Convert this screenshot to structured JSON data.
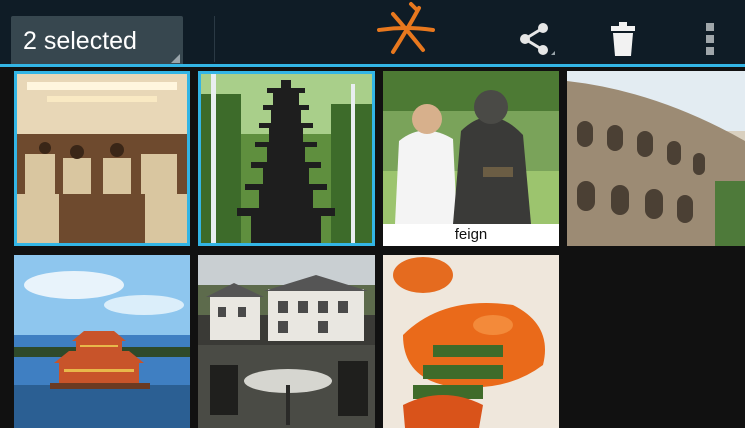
{
  "actionbar": {
    "selection_label": "2 selected",
    "icons": [
      "share-icon",
      "trash-icon",
      "overflow-menu-icon"
    ],
    "accent_color": "#33b5e5"
  },
  "gallery": {
    "items": [
      {
        "name": "train-interior",
        "selected": true
      },
      {
        "name": "pagoda",
        "selected": true
      },
      {
        "name": "statue-photo",
        "selected": false,
        "caption": "feign"
      },
      {
        "name": "colosseum",
        "selected": false
      },
      {
        "name": "lake-palace",
        "selected": false
      },
      {
        "name": "village-terrace",
        "selected": false
      },
      {
        "name": "food-dish",
        "selected": false
      }
    ]
  }
}
